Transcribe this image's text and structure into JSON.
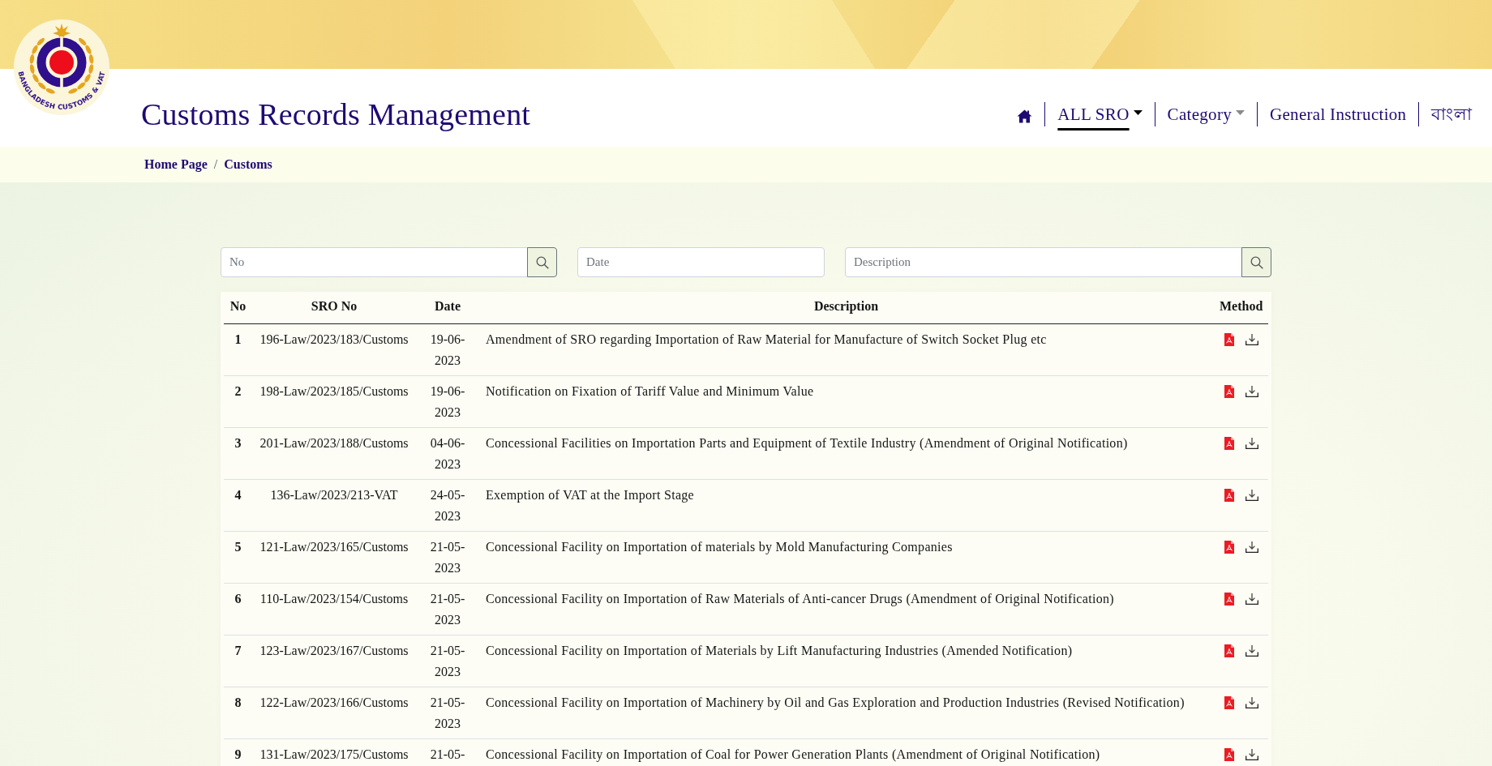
{
  "header": {
    "logo_text": "BANGLADESH CUSTOMS & VAT",
    "title": "Customs Records Management"
  },
  "nav": [
    {
      "kind": "home",
      "selected": false
    },
    {
      "kind": "dropdown",
      "label": "ALL SRO",
      "selected": true
    },
    {
      "kind": "dropdown",
      "label": "Category",
      "selected": false
    },
    {
      "kind": "link",
      "label": "General Instruction",
      "selected": false
    },
    {
      "kind": "link",
      "label": "বাংলা",
      "selected": false
    }
  ],
  "breadcrumb": {
    "items": [
      "Home Page",
      "Customs"
    ],
    "separator": "/"
  },
  "search_fields": [
    {
      "kind": "with_button",
      "placeholder": "No"
    },
    {
      "kind": "plain",
      "placeholder": "Date"
    },
    {
      "kind": "with_button",
      "placeholder": "Description"
    }
  ],
  "table": {
    "columns": [
      "No",
      "SRO No",
      "Date",
      "Description",
      "Method"
    ],
    "rows": [
      {
        "no": "1",
        "sro_no": "196-Law/2023/183/Customs",
        "date": "19-06-2023",
        "description": "Amendment of SRO regarding Importation of Raw Material for Manufacture of Switch Socket Plug etc"
      },
      {
        "no": "2",
        "sro_no": "198-Law/2023/185/Customs",
        "date": "19-06-2023",
        "description": "Notification on Fixation of Tariff Value and Minimum Value"
      },
      {
        "no": "3",
        "sro_no": "201-Law/2023/188/Customs",
        "date": "04-06-2023",
        "description": "Concessional Facilities on Importation Parts and Equipment of Textile Industry (Amendment of Original Notification)"
      },
      {
        "no": "4",
        "sro_no": "136-Law/2023/213-VAT",
        "date": "24-05-2023",
        "description": "Exemption of VAT at the Import Stage"
      },
      {
        "no": "5",
        "sro_no": "121-Law/2023/165/Customs",
        "date": "21-05-2023",
        "description": "Concessional Facility on Importation of materials by Mold Manufacturing Companies"
      },
      {
        "no": "6",
        "sro_no": "110-Law/2023/154/Customs",
        "date": "21-05-2023",
        "description": "Concessional Facility on Importation of Raw Materials of Anti-cancer Drugs (Amendment of Original Notification)"
      },
      {
        "no": "7",
        "sro_no": "123-Law/2023/167/Customs",
        "date": "21-05-2023",
        "description": "Concessional Facility on Importation of Materials by Lift Manufacturing Industries (Amended Notification)"
      },
      {
        "no": "8",
        "sro_no": "122-Law/2023/166/Customs",
        "date": "21-05-2023",
        "description": "Concessional Facility on Importation of Machinery by Oil and Gas Exploration and Production Industries (Revised Notification)"
      },
      {
        "no": "9",
        "sro_no": "131-Law/2023/175/Customs",
        "date": "21-05-",
        "description": "Concessional Facility on Importation of Coal for Power Generation Plants (Amendment of Original Notification)"
      }
    ]
  }
}
